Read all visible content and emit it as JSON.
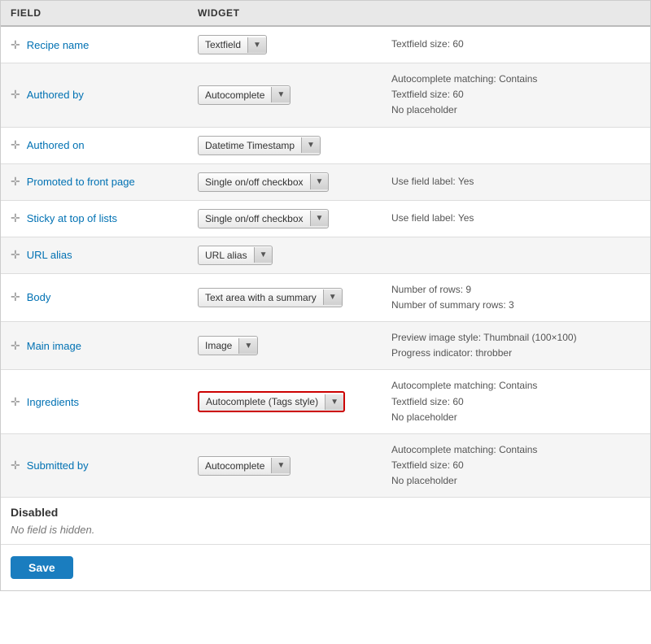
{
  "header": {
    "col1": "FIELD",
    "col2": "WIDGET",
    "col3": ""
  },
  "rows": [
    {
      "id": "recipe-name",
      "field": "Recipe name",
      "widget": "Textfield",
      "info": "Textfield size: 60",
      "highlighted": false
    },
    {
      "id": "authored-by",
      "field": "Authored by",
      "widget": "Autocomplete",
      "info": "Autocomplete matching: Contains\nTextfield size: 60\nNo placeholder",
      "highlighted": false
    },
    {
      "id": "authored-on",
      "field": "Authored on",
      "widget": "Datetime Timestamp",
      "info": "",
      "highlighted": false
    },
    {
      "id": "promoted-front",
      "field": "Promoted to front page",
      "widget": "Single on/off checkbox",
      "info": "Use field label: Yes",
      "highlighted": false
    },
    {
      "id": "sticky-top",
      "field": "Sticky at top of lists",
      "widget": "Single on/off checkbox",
      "info": "Use field label: Yes",
      "highlighted": false
    },
    {
      "id": "url-alias",
      "field": "URL alias",
      "widget": "URL alias",
      "info": "",
      "highlighted": false
    },
    {
      "id": "body",
      "field": "Body",
      "widget": "Text area with a summary",
      "info": "Number of rows: 9\nNumber of summary rows: 3",
      "highlighted": false
    },
    {
      "id": "main-image",
      "field": "Main image",
      "widget": "Image",
      "info": "Preview image style: Thumbnail (100×100)\nProgress indicator: throbber",
      "highlighted": false
    },
    {
      "id": "ingredients",
      "field": "Ingredients",
      "widget": "Autocomplete (Tags style)",
      "info": "Autocomplete matching: Contains\nTextfield size: 60\nNo placeholder",
      "highlighted": true
    },
    {
      "id": "submitted-by",
      "field": "Submitted by",
      "widget": "Autocomplete",
      "info": "Autocomplete matching: Contains\nTextfield size: 60\nNo placeholder",
      "highlighted": false
    }
  ],
  "disabled_section": {
    "title": "Disabled",
    "message": "No field is hidden."
  },
  "save_button": "Save"
}
